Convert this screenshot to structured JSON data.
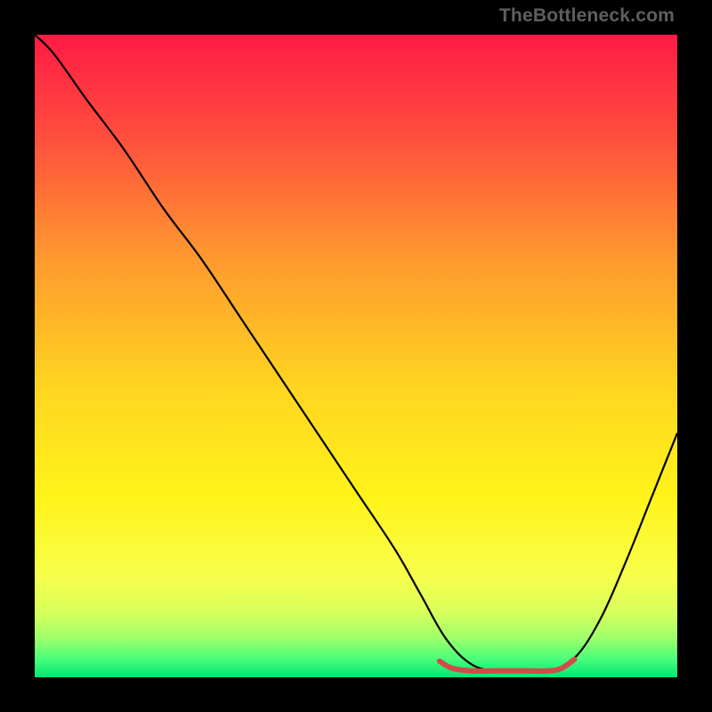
{
  "watermark": "TheBottleneck.com",
  "chart_data": {
    "type": "line",
    "title": "",
    "xlabel": "",
    "ylabel": "",
    "xlim": [
      0,
      100
    ],
    "ylim": [
      0,
      100
    ],
    "grid": false,
    "legend": false,
    "background_gradient": {
      "stops": [
        {
          "offset": 0.0,
          "color": "#ff1a46"
        },
        {
          "offset": 0.15,
          "color": "#ff4b3e"
        },
        {
          "offset": 0.35,
          "color": "#ff9a2f"
        },
        {
          "offset": 0.55,
          "color": "#ffd520"
        },
        {
          "offset": 0.72,
          "color": "#fff31a"
        },
        {
          "offset": 0.84,
          "color": "#f8ff4a"
        },
        {
          "offset": 0.9,
          "color": "#d7ff5c"
        },
        {
          "offset": 0.94,
          "color": "#9bff6a"
        },
        {
          "offset": 0.97,
          "color": "#4dff7a"
        },
        {
          "offset": 1.0,
          "color": "#00e676"
        }
      ]
    },
    "series": [
      {
        "name": "bottleneck-curve",
        "stroke": "#000000",
        "stroke_width": 2.2,
        "x": [
          0,
          3,
          8,
          14,
          20,
          26,
          32,
          38,
          44,
          50,
          56,
          60,
          64,
          68,
          72,
          76,
          80,
          84,
          88,
          92,
          96,
          100
        ],
        "y": [
          100,
          97,
          90,
          82,
          73,
          65,
          56,
          47,
          38,
          29,
          20,
          13,
          6,
          2,
          1,
          1,
          1,
          3,
          9,
          18,
          28,
          38
        ]
      },
      {
        "name": "optimal-band-marker",
        "stroke": "#d24a4a",
        "stroke_width": 6,
        "linecap": "round",
        "x": [
          63,
          65,
          68,
          72,
          76,
          80,
          82,
          84
        ],
        "y": [
          2.5,
          1.4,
          1.0,
          1.0,
          1.0,
          1.0,
          1.4,
          2.8
        ]
      }
    ]
  }
}
